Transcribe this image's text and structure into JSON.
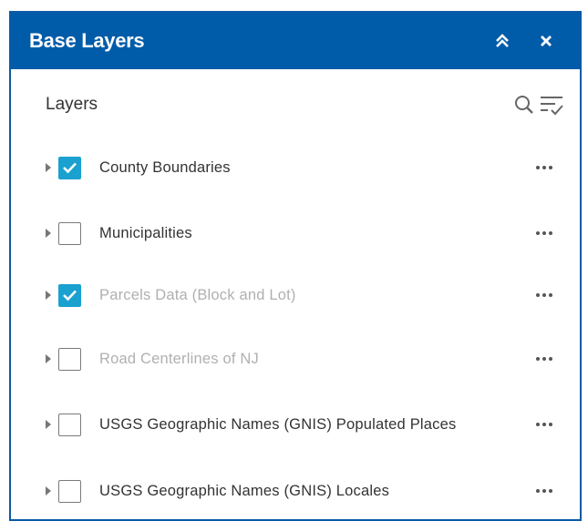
{
  "panel": {
    "title": "Base Layers",
    "collapse_icon": "double-chevron-up-icon",
    "close_icon": "close-icon"
  },
  "layers_header": {
    "title": "Layers",
    "search_icon": "search-icon",
    "filter_icon": "filter-list-icon"
  },
  "layers": [
    {
      "label": "County Boundaries",
      "checked": true,
      "dimmed": false
    },
    {
      "label": "Municipalities",
      "checked": false,
      "dimmed": false
    },
    {
      "label": "Parcels Data (Block and Lot)",
      "checked": true,
      "dimmed": true
    },
    {
      "label": "Road Centerlines of NJ",
      "checked": false,
      "dimmed": true
    },
    {
      "label": "USGS Geographic Names (GNIS) Populated Places",
      "checked": false,
      "dimmed": false
    },
    {
      "label": "USGS Geographic Names (GNIS) Locales",
      "checked": false,
      "dimmed": false
    }
  ],
  "colors": {
    "header_bg": "#005ca8",
    "checkbox_checked": "#1aa1cf",
    "text": "#333333",
    "text_dimmed": "#b0b0b0"
  }
}
